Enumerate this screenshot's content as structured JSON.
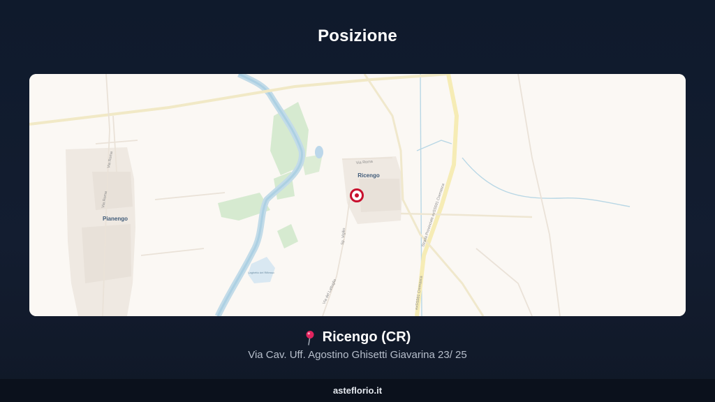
{
  "page": {
    "title": "Posizione"
  },
  "map": {
    "town_labels": [
      "Ricengo",
      "Pianengo"
    ],
    "street_labels": [
      "Via Roma",
      "Via Roma",
      "Via Roma",
      "Strada Provinciale exSS591 Cremasca",
      "exSS591 Cremasca",
      "Via del Lattuglio",
      "Sp. Vigilio"
    ],
    "lake_label": "Laghetto del Riflesso",
    "marker_color": "#c8102e"
  },
  "location": {
    "name": "Ricengo (CR)",
    "address": "Via Cav. Uff. Agostino Ghisetti Giavarina 23/ 25",
    "pin_icon": "round-pushpin-icon"
  },
  "footer": {
    "brand": "asteflorio.it"
  }
}
